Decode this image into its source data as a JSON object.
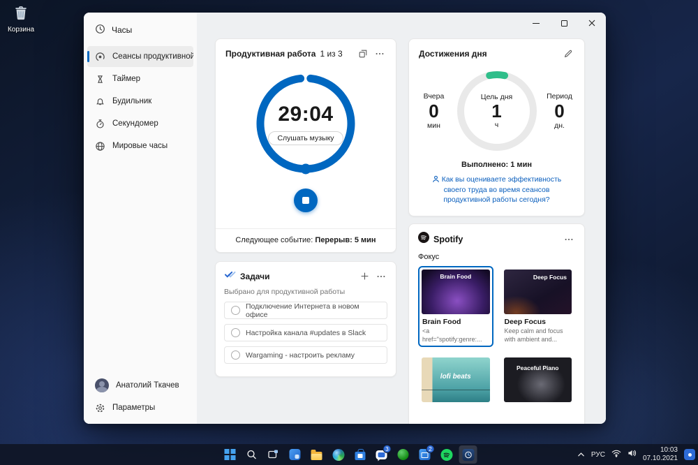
{
  "colors": {
    "accent": "#0067c0",
    "ring_green": "#2fbe8a",
    "link_blue": "#0b5fbd",
    "badge_blue": "#2e6bd6"
  },
  "desktop": {
    "recycle_bin": "Корзина"
  },
  "sidebar": {
    "app_title": "Часы",
    "items": [
      {
        "label": "Сеансы продуктивной р"
      },
      {
        "label": "Таймер"
      },
      {
        "label": "Будильник"
      },
      {
        "label": "Секундомер"
      },
      {
        "label": "Мировые часы"
      }
    ],
    "user": "Анатолий Ткачев",
    "settings": "Параметры"
  },
  "focus": {
    "title": "Продуктивная работа",
    "counter": "1 из 3",
    "time": "29:04",
    "music": "Слушать музыку",
    "next_label": "Следующее событие: ",
    "next_value": "Перерыв: 5 мин"
  },
  "achievements": {
    "title": "Достижения дня",
    "yesterday_label": "Вчера",
    "yesterday_value": "0",
    "yesterday_unit": "мин",
    "goal_label": "Цель дня",
    "goal_value": "1",
    "goal_unit": "ч",
    "period_label": "Период",
    "period_value": "0",
    "period_unit": "дн.",
    "done": "Выполнено: 1 мин",
    "survey": "Как вы оцениваете эффективность своего труда во время сеансов продуктивной работы сегодня?"
  },
  "tasks": {
    "title": "Задачи",
    "subtitle": "Выбрано для продуктивной работы",
    "items": [
      "Подключение Интернета в новом офисе",
      "Настройка канала #updates в Slack",
      "Wargaming - настроить рекламу"
    ]
  },
  "spotify": {
    "title": "Spotify",
    "section": "Фокус",
    "playlists": [
      {
        "name": "Brain Food",
        "desc": "<a href=\"spotify:genre:...",
        "selected": true
      },
      {
        "name": "Deep Focus",
        "desc": "Keep calm and focus with ambient and..."
      },
      {
        "name": "lofi beats",
        "desc": ""
      },
      {
        "name": "Peaceful Piano",
        "desc": ""
      }
    ]
  },
  "taskbar": {
    "pinned": [
      {
        "name": "start"
      },
      {
        "name": "search"
      },
      {
        "name": "task-view"
      },
      {
        "name": "widgets"
      },
      {
        "name": "file-explorer"
      },
      {
        "name": "edge"
      },
      {
        "name": "store"
      },
      {
        "name": "chat",
        "badge": "3"
      },
      {
        "name": "xbox"
      },
      {
        "name": "mail",
        "badge": "2"
      },
      {
        "name": "spotify"
      },
      {
        "name": "clock",
        "active": true
      }
    ],
    "tray": {
      "language": "РУС",
      "time": "10:03",
      "date": "07.10.2021"
    }
  }
}
